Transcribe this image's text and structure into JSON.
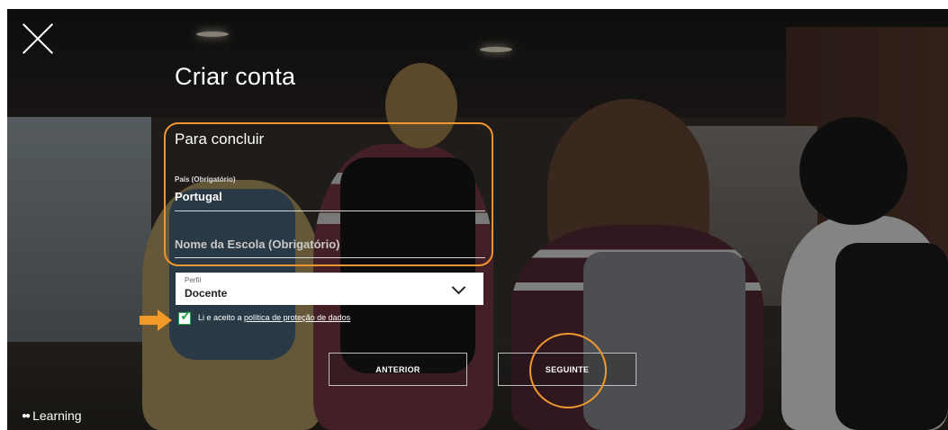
{
  "page": {
    "title": "Criar conta",
    "subtitle": "Para concluir"
  },
  "form": {
    "country_label": "País (Obrigatório)",
    "country_value": "Portugal",
    "school_placeholder": "Nome da Escola (Obrigatório)",
    "profile_label": "Perfil",
    "profile_value": "Docente",
    "consent_checked": true,
    "consent_text": "Li e aceito a ",
    "consent_link": "política de proteção de dados"
  },
  "buttons": {
    "previous": "ANTERIOR",
    "next": "SEGUINTE"
  },
  "brand": {
    "name": "Learning"
  },
  "colors": {
    "highlight": "#f0962e",
    "arrow": "#f59a28",
    "check": "#22a04a"
  },
  "icons": [
    "close-icon",
    "chevron-down-icon",
    "checkmark-icon",
    "arrow-right-icon"
  ]
}
